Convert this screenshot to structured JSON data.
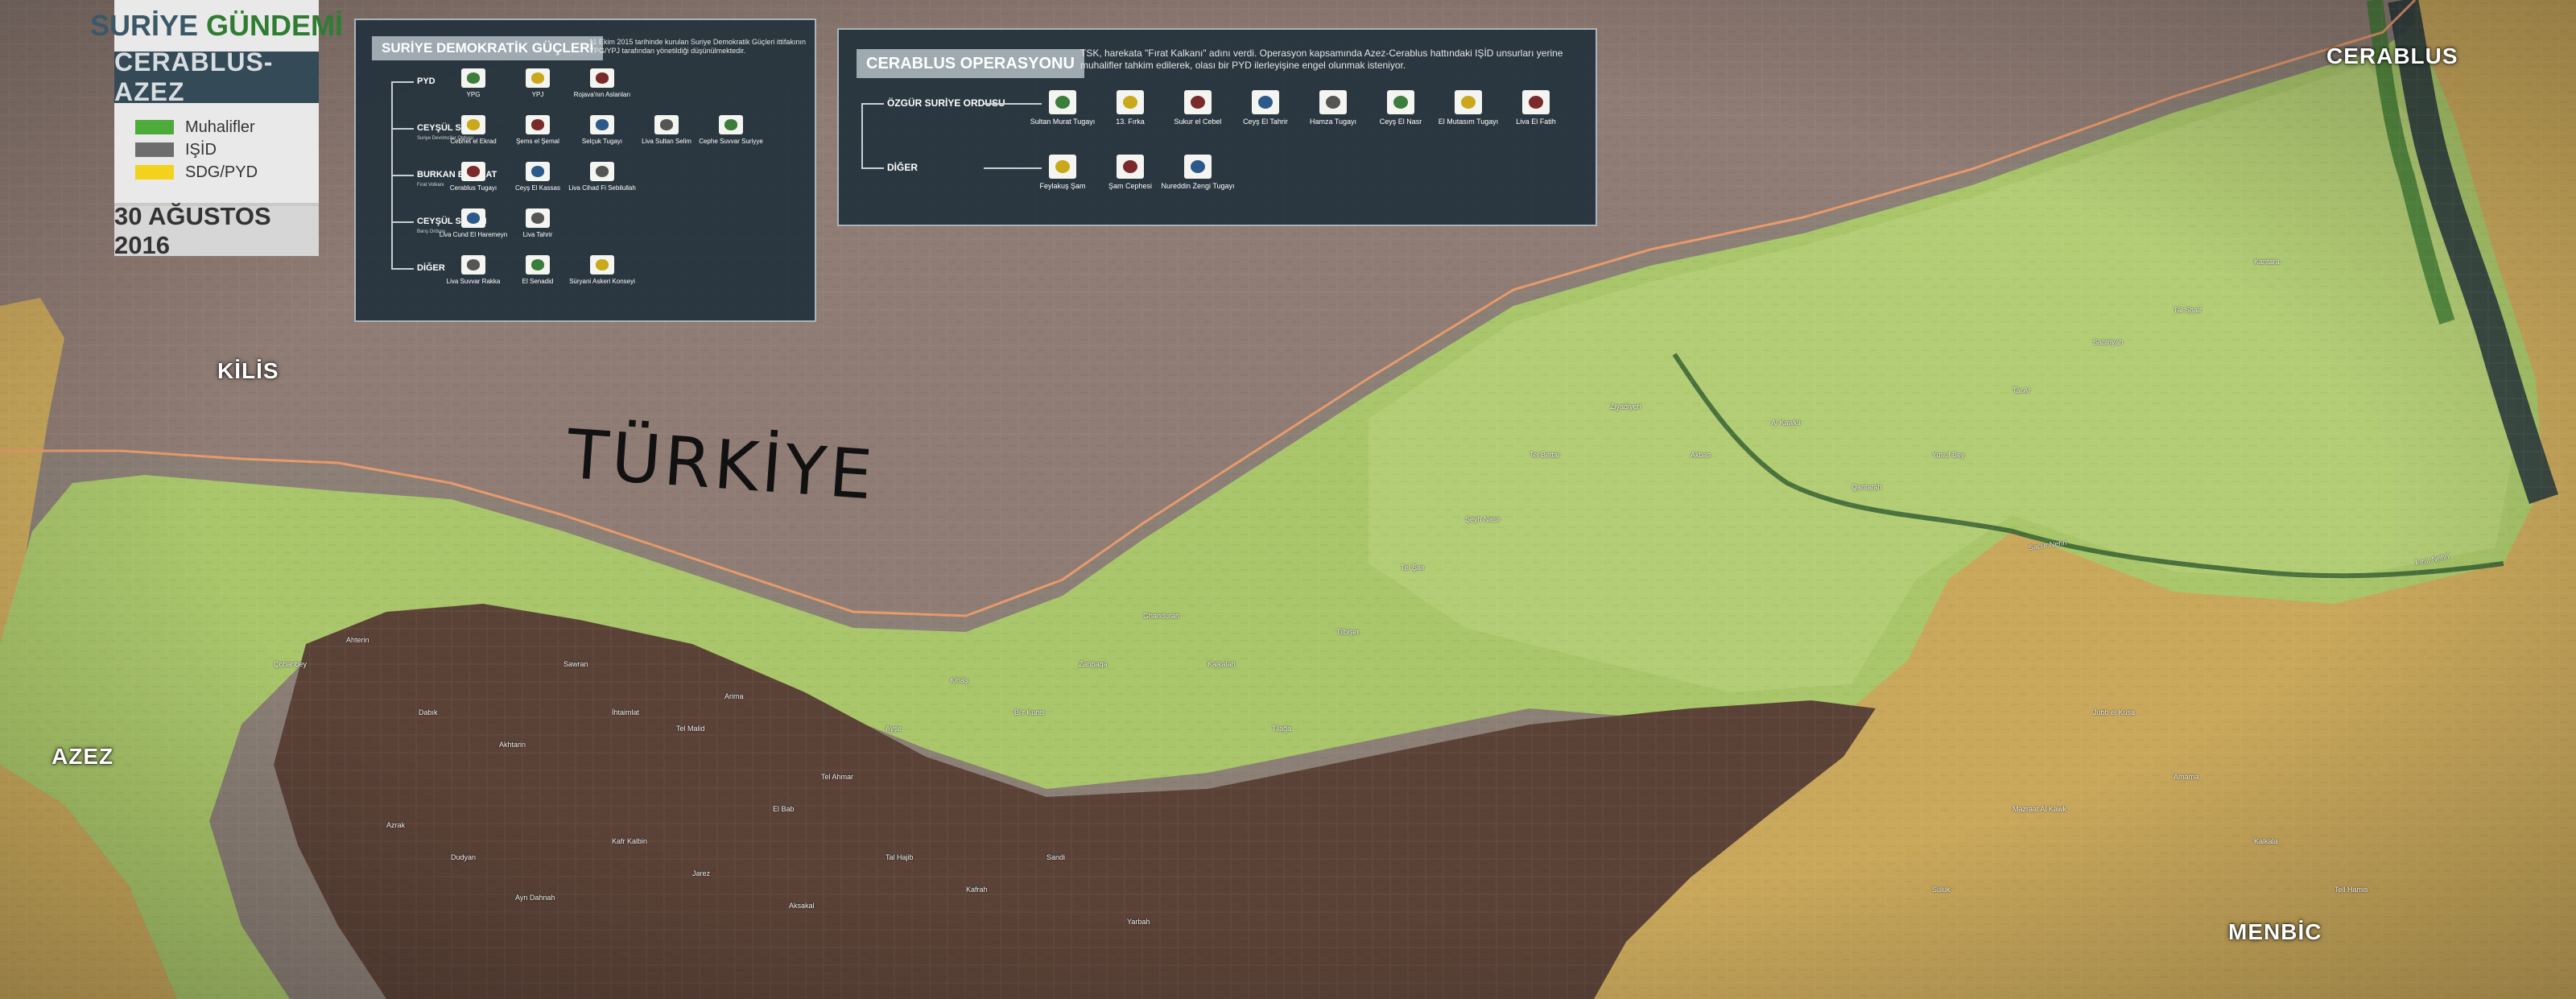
{
  "colors": {
    "muhalifler": "#4cab39",
    "isid": "#6d6d6d",
    "sdg_pyd": "#f2d21c",
    "turkey_territory": "#8f7c74",
    "opposition_zone": "#a8c86a",
    "isid_zone": "#5a4236",
    "sdg_zone": "#c8a85a",
    "panel_bg": "#24333d"
  },
  "title_panel": {
    "line1": "SURİYE",
    "line1_accent": "GÜNDEMİ",
    "subtitle": "CERABLUS-AZEZ",
    "legend": [
      {
        "label": "Muhalifler",
        "color": "#4cab39"
      },
      {
        "label": "IŞİD",
        "color": "#6d6d6d"
      },
      {
        "label": "SDG/PYD",
        "color": "#f2d21c"
      }
    ],
    "date": "30 AĞUSTOS 2016"
  },
  "sdg_panel": {
    "title": "SURİYE DEMOKRATİK GÜÇLERİ",
    "description": "11 Ekim 2015 tarihinde kurulan Suriye Demokratik Güçleri ittifakının YPG/YPJ tarafından yönetildiği düşünülmektedir.",
    "groups": [
      {
        "name": "PYD",
        "note": "",
        "units": [
          {
            "name": "YPG",
            "icon": "ypg-flag-icon"
          },
          {
            "name": "YPJ",
            "icon": "ypj-flag-icon"
          },
          {
            "name": "Rojava'nın Aslanları",
            "icon": "rojava-lions-flag-icon"
          }
        ]
      },
      {
        "name": "CEYŞÜL SUVAR",
        "note": "Suriye Devrimciler Ordusu",
        "units": [
          {
            "name": "Cebhet el Ekrad",
            "icon": "cebhet-el-ekrad-emblem-icon"
          },
          {
            "name": "Şems el Şemal",
            "icon": "sems-el-semal-emblem-icon"
          },
          {
            "name": "Selçuk Tugayı",
            "icon": "selcuk-tugayi-emblem-icon"
          },
          {
            "name": "Liva Sultan Selim",
            "icon": "liva-sultan-selim-emblem-icon"
          },
          {
            "name": "Cephe Suvvar Suriyye",
            "icon": "cephe-suvvar-emblem-icon"
          }
        ]
      },
      {
        "name": "BURKAN EL FIRAT",
        "note": "Fırat Volkanı",
        "units": [
          {
            "name": "Cerablus Tugayı",
            "icon": "cerablus-tugayi-emblem-icon"
          },
          {
            "name": "Ceyş El Kassas",
            "icon": "ceys-el-kassas-emblem-icon"
          },
          {
            "name": "Liva Cihad Fi Sebilullah",
            "icon": "liva-cihad-emblem-icon"
          }
        ]
      },
      {
        "name": "CEYŞÜL SALAM",
        "note": "Barış Ordusu",
        "units": [
          {
            "name": "Liva Cund El Haremeyn",
            "icon": "liva-cund-el-haremeyn-emblem-icon"
          },
          {
            "name": "Liva Tahrir",
            "icon": "liva-tahrir-emblem-icon"
          }
        ]
      },
      {
        "name": "DİĞER",
        "note": "",
        "units": [
          {
            "name": "Liva Suvvar Rakka",
            "icon": "liva-suvvar-rakka-emblem-icon"
          },
          {
            "name": "El Senadid",
            "icon": "el-senadid-emblem-icon"
          },
          {
            "name": "Süryani Askeri Konseyi",
            "icon": "suryani-askeri-konseyi-emblem-icon"
          }
        ]
      }
    ]
  },
  "op_panel": {
    "title": "CERABLUS OPERASYONU",
    "description": "TSK, harekata \"Fırat Kalkanı\" adını verdi. Operasyon kapsamında Azez-Cerablus hattındaki IŞİD unsurları yerine muhalifler tahkim edilerek, olası bir PYD ilerleyişine engel olunmak isteniyor.",
    "groups": [
      {
        "name": "ÖZGÜR SURİYE ORDUSU",
        "units": [
          {
            "name": "Sultan Murat Tugayı",
            "icon": "sultan-murat-emblem-icon"
          },
          {
            "name": "13. Fırka",
            "icon": "13-firka-flag-icon"
          },
          {
            "name": "Sukur el Cebel",
            "icon": "sukur-el-cebel-emblem-icon"
          },
          {
            "name": "Ceyş El Tahrir",
            "icon": "ceys-el-tahrir-emblem-icon"
          },
          {
            "name": "Hamza Tugayı",
            "icon": "hamza-tugayi-emblem-icon"
          },
          {
            "name": "Ceyş El Nasr",
            "icon": "ceys-el-nasr-emblem-icon"
          },
          {
            "name": "El Mutasım Tugayı",
            "icon": "el-mutasim-emblem-icon"
          },
          {
            "name": "Liva El Fatih",
            "icon": "liva-el-fatih-emblem-icon"
          }
        ]
      },
      {
        "name": "DİĞER",
        "units": [
          {
            "name": "Feylakuş Şam",
            "icon": "feylakus-sam-emblem-icon"
          },
          {
            "name": "Şam Cephesi",
            "icon": "sam-cephesi-emblem-icon"
          },
          {
            "name": "Nureddin Zengi Tugayı",
            "icon": "nureddin-zengi-emblem-icon"
          }
        ]
      }
    ]
  },
  "map": {
    "country_label": "TÜRKİYE",
    "cities": [
      {
        "name": "KİLİS",
        "key": "kilis"
      },
      {
        "name": "AZEZ",
        "key": "azez"
      },
      {
        "name": "CERABLUS",
        "key": "cerablus"
      },
      {
        "name": "MENBİC",
        "key": "menbic"
      }
    ],
    "rivers": [
      "Sacur Nehri",
      "Fırat Nehri"
    ],
    "villages": [
      "Çobanbey",
      "Ahterin",
      "Dabık",
      "Akhtarin",
      "Sawran",
      "İhtaimlat",
      "Tel Malid",
      "Arima",
      "El Bab",
      "Tel Ahmar",
      "Azrak",
      "Dudyan",
      "Ayn Dahnah",
      "Kafr Kalbin",
      "Jarez",
      "Aksakal",
      "Tal Hajib",
      "Kafrah",
      "Sandi",
      "Yarbah",
      "Ayşe",
      "Kinaş",
      "Bi'r Kunis",
      "Zanbaqa",
      "Ghandurah",
      "Kalkalah",
      "Tilağa",
      "Tilbişer",
      "Tel Şair",
      "Şeyh Nasir",
      "Tel Bettal",
      "Ziyadiyeh",
      "Akbas",
      "Al Kawkli",
      "Qantarah",
      "Yusuf Bey",
      "Tal Ar",
      "Sabiriyah",
      "Tal Shair",
      "Kantara",
      "Jubb el Kusa",
      "Amarna",
      "Kalkala",
      "Tell Hamis",
      "Mazraat Al Kawk",
      "Suluk"
    ]
  }
}
